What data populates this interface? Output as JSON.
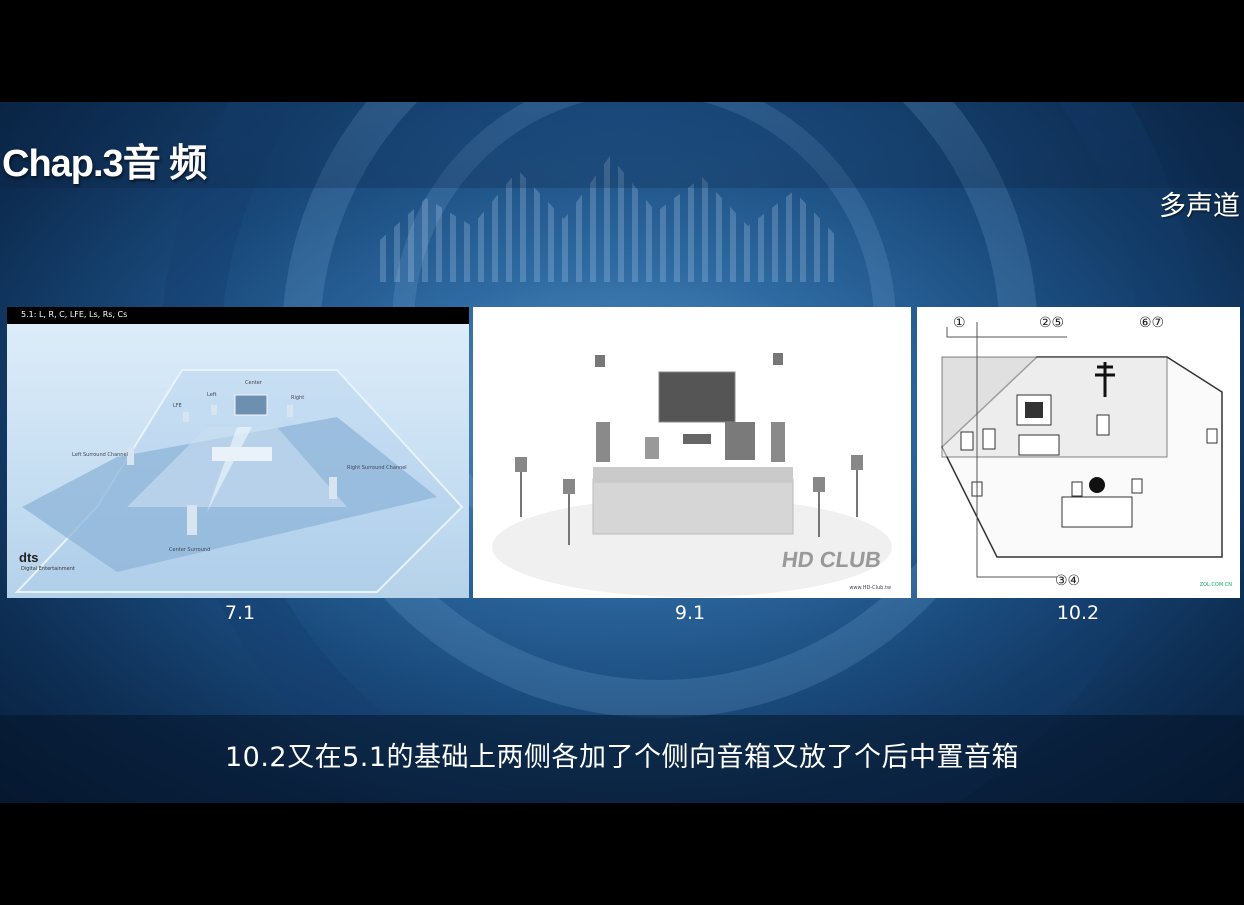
{
  "slide": {
    "chapter_title": "Chap.3音 频",
    "section_title": "多声道"
  },
  "panels": [
    {
      "caption": "7.1",
      "topbar": "5.1: L, R, C, LFE, Ls, Rs, Cs",
      "labels": {
        "center": "Center",
        "left": "Left",
        "right": "Right",
        "lfe": "LFE",
        "left_surround": "Left Surround Channel",
        "right_surround": "Right Surround Channel",
        "center_surround": "Center Surround"
      },
      "logo": "dts",
      "logo_sub": "Digital Entertainment"
    },
    {
      "caption": "9.1",
      "logo": "HD CLUB",
      "logo_sub": "www.HD-Club.tw"
    },
    {
      "caption": "10.2",
      "markers": [
        "①",
        "②⑤",
        "⑥⑦",
        "③④"
      ],
      "logo": "ZOL.COM.CN"
    }
  ],
  "subtitle": "10.2又在5.1的基础上两侧各加了个侧向音箱又放了个后中置音箱"
}
